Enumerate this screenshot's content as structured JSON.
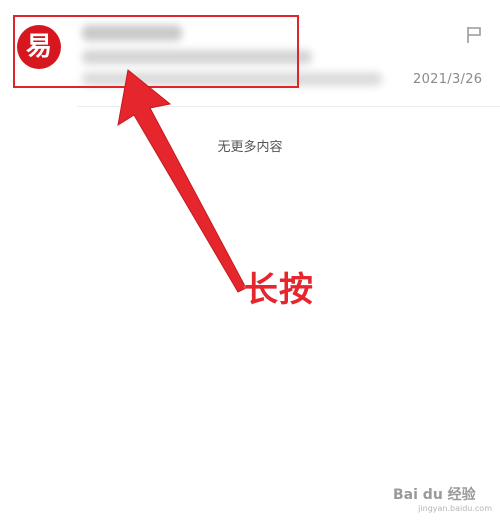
{
  "mail_item": {
    "avatar_glyph": "易",
    "avatar_color": "#d7171f",
    "sender_blurred": true,
    "subject_blurred": true,
    "date": "2021/3/26",
    "flag_icon": "flag-outline-icon"
  },
  "list_end": {
    "text": "无更多内容"
  },
  "annotation": {
    "text": "长按",
    "color": "#e5262d"
  },
  "watermark": {
    "brand": "Bai du 经验",
    "url": "jingyan.baidu.com"
  }
}
